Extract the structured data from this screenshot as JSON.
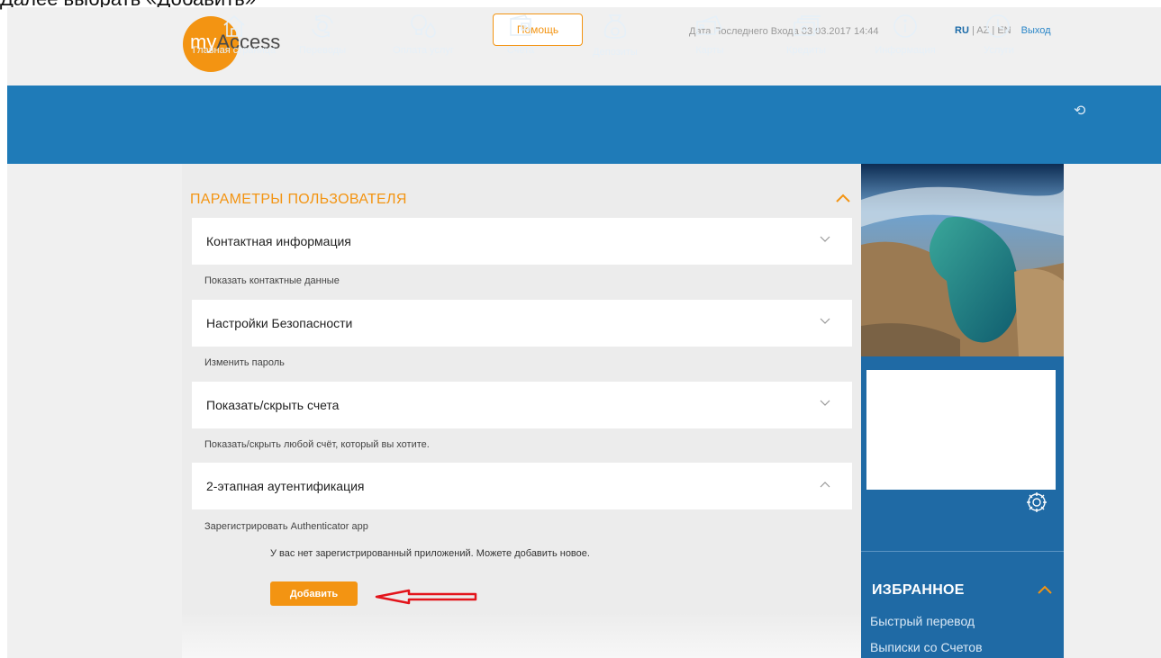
{
  "caption": "Далее выбрать «Добавить»",
  "header": {
    "logo_my": "my",
    "logo_access": "Access",
    "help_label": "Помощь",
    "last_login": "Дата Последнего Входа 03.03.2017 14:44",
    "lang_ru": "RU",
    "lang_az": "AZ",
    "lang_en": "EN",
    "logout_label": "Выход",
    "brand_color": "#f39412"
  },
  "nav": {
    "bg_color": "#1f7bb8",
    "items": [
      {
        "label": "Главная страница",
        "icon": "home-icon"
      },
      {
        "label": "Переводы",
        "icon": "transfer-icon"
      },
      {
        "label": "Оплата услуг",
        "icon": "utilities-icon"
      },
      {
        "label": "Счета",
        "icon": "wallet-icon"
      },
      {
        "label": "Депозиты",
        "icon": "money-bag-icon"
      },
      {
        "label": "Карты",
        "icon": "cards-icon"
      },
      {
        "label": "Кредиты",
        "icon": "credits-icon"
      },
      {
        "label": "Информация",
        "icon": "info-icon"
      },
      {
        "label": "Услуги",
        "icon": "clock-icon"
      }
    ]
  },
  "main": {
    "section_title": "ПАРАМЕТРЫ ПОЛЬЗОВАТЕЛЯ",
    "accordions": [
      {
        "title": "Контактная информация",
        "sub": "Показать контактные данные",
        "expanded": false
      },
      {
        "title": "Настройки Безопасности",
        "sub": "Изменить пароль",
        "expanded": false
      },
      {
        "title": "Показать/скрыть счета",
        "sub": "Показать/скрыть любой счёт, который вы хотите.",
        "expanded": false
      },
      {
        "title": "2-этапная аутентификация",
        "sub": "Зарегистрировать Authenticator app",
        "expanded": true
      }
    ],
    "note": "У вас нет зарегистрированный приложений. Можете добавить новое.",
    "add_label": "Добавить"
  },
  "sidebar": {
    "favorites_title": "ИЗБРАННОЕ",
    "links": [
      "Быстрый перевод",
      "Выписки со Счетов"
    ]
  }
}
